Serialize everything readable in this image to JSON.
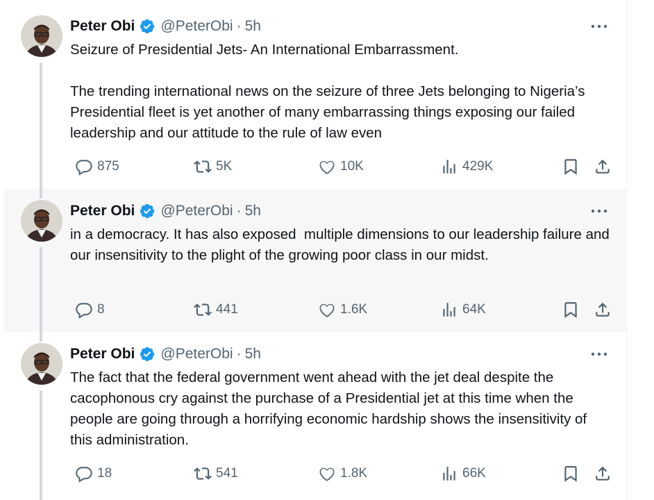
{
  "author": {
    "name": "Peter Obi",
    "handle": "@PeterObi",
    "separator": "·",
    "time": "5h"
  },
  "icons": {
    "verified": "verified-badge-icon",
    "more": "more-horizontal-icon",
    "reply": "reply-icon",
    "retweet": "retweet-icon",
    "like": "heart-icon",
    "views": "views-chart-icon",
    "bookmark": "bookmark-icon",
    "share": "share-icon"
  },
  "colors": {
    "verified": "#1d9bf0",
    "text": "#0f1419",
    "secondary": "#536471",
    "hover_bg": "#f7f7f7",
    "thread_line": "#cfd9de"
  },
  "tweets": [
    {
      "text": "Seizure of Presidential Jets- An International Embarrassment.\n\nThe trending international news on the seizure of three Jets belonging to Nigeria’s Presidential fleet is yet another of many embarrassing things exposing our failed leadership and our attitude to the rule of law even",
      "replies": "875",
      "retweets": "5K",
      "likes": "10K",
      "views": "429K"
    },
    {
      "text": "in a democracy. It has also exposed  multiple dimensions to our leadership failure and our insensitivity to the plight of the growing poor class in our midst.",
      "replies": "8",
      "retweets": "441",
      "likes": "1.6K",
      "views": "64K"
    },
    {
      "text": "The fact that the federal government went ahead with the jet deal despite the cacophonous cry against the purchase of a Presidential jet at this time when the people are going through a horrifying economic hardship shows the insensitivity of this administration.",
      "replies": "18",
      "retweets": "541",
      "likes": "1.8K",
      "views": "66K"
    }
  ]
}
